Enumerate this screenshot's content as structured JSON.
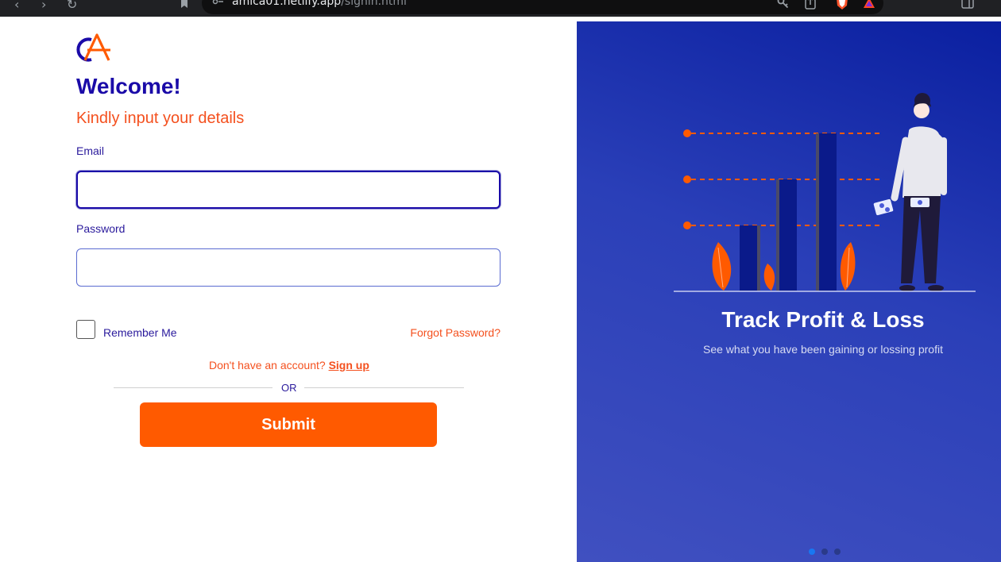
{
  "browser": {
    "url_host": "amica01.netlify.app",
    "url_path": "/signin.html",
    "icons": [
      "back-icon",
      "forward-icon",
      "reload-icon",
      "bookmark-icon",
      "site-settings-icon",
      "key-icon",
      "share-icon",
      "brave-shield-icon",
      "brave-rewards-icon",
      "sidebar-icon"
    ]
  },
  "form": {
    "welcome": "Welcome!",
    "subtitle": "Kindly input your details",
    "email_label": "Email",
    "email_value": "",
    "password_label": "Password",
    "password_value": "",
    "remember_label": "Remember Me",
    "remember_checked": false,
    "forgot_label": "Forgot Password?",
    "signup_prompt": "Don't have an account?",
    "signup_link": "Sign up",
    "or_label": "OR",
    "submit_label": "Submit"
  },
  "carousel": {
    "title": "Track Profit & Loss",
    "subtitle": "See what you have been gaining or lossing profit",
    "slide_count": 3,
    "active_slide": 1
  },
  "colors": {
    "brand_blue": "#1a0aa8",
    "brand_orange": "#ff5a00",
    "accent_orange": "#f4501e",
    "panel_blue": "#1a2aa8"
  }
}
